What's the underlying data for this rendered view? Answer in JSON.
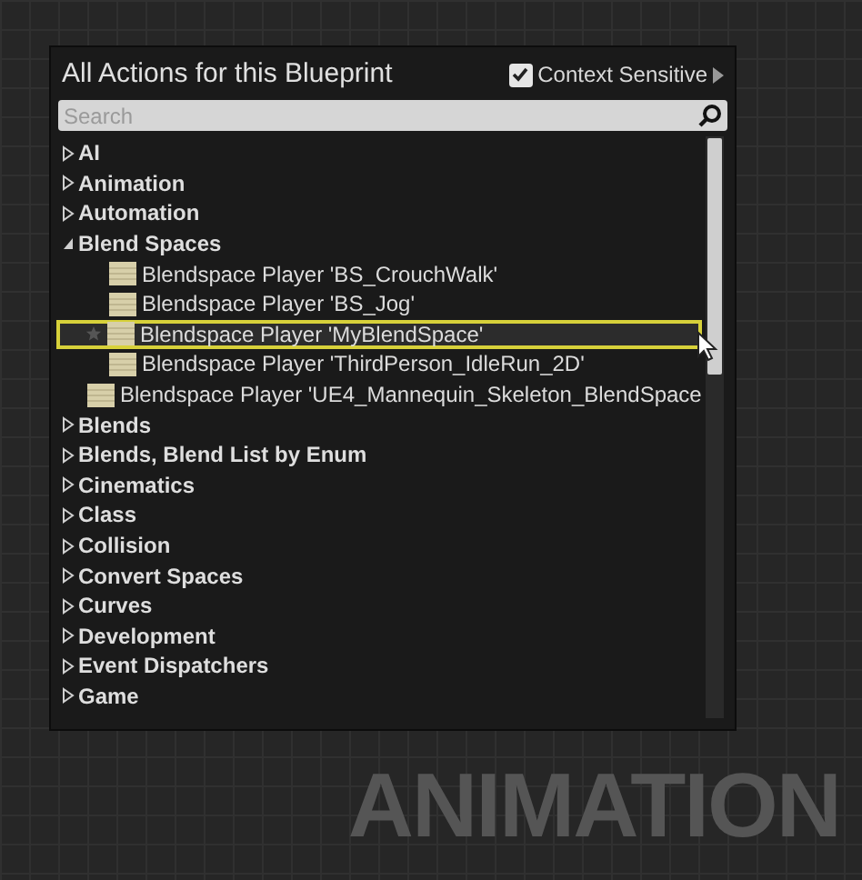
{
  "panel": {
    "title": "All Actions for this Blueprint",
    "context_sensitive": {
      "label": "Context Sensitive",
      "checked": true
    },
    "search": {
      "placeholder": "Search"
    },
    "tree": [
      {
        "label": "AI",
        "expanded": false
      },
      {
        "label": "Animation",
        "expanded": false
      },
      {
        "label": "Automation",
        "expanded": false
      },
      {
        "label": "Blend Spaces",
        "expanded": true,
        "children": [
          {
            "label": "Blendspace Player 'BS_CrouchWalk'",
            "selected": false
          },
          {
            "label": "Blendspace Player 'BS_Jog'",
            "selected": false
          },
          {
            "label": "Blendspace Player 'MyBlendSpace'",
            "selected": true
          },
          {
            "label": "Blendspace Player 'ThirdPerson_IdleRun_2D'",
            "selected": false
          },
          {
            "label": "Blendspace Player 'UE4_Mannequin_Skeleton_BlendSpace",
            "selected": false
          }
        ]
      },
      {
        "label": "Blends",
        "expanded": false
      },
      {
        "label": "Blends, Blend List by Enum",
        "expanded": false
      },
      {
        "label": "Cinematics",
        "expanded": false
      },
      {
        "label": "Class",
        "expanded": false
      },
      {
        "label": "Collision",
        "expanded": false
      },
      {
        "label": "Convert Spaces",
        "expanded": false
      },
      {
        "label": "Curves",
        "expanded": false
      },
      {
        "label": "Development",
        "expanded": false
      },
      {
        "label": "Event Dispatchers",
        "expanded": false
      },
      {
        "label": "Game",
        "expanded": false
      }
    ]
  },
  "graph_label": "ANIMATION"
}
